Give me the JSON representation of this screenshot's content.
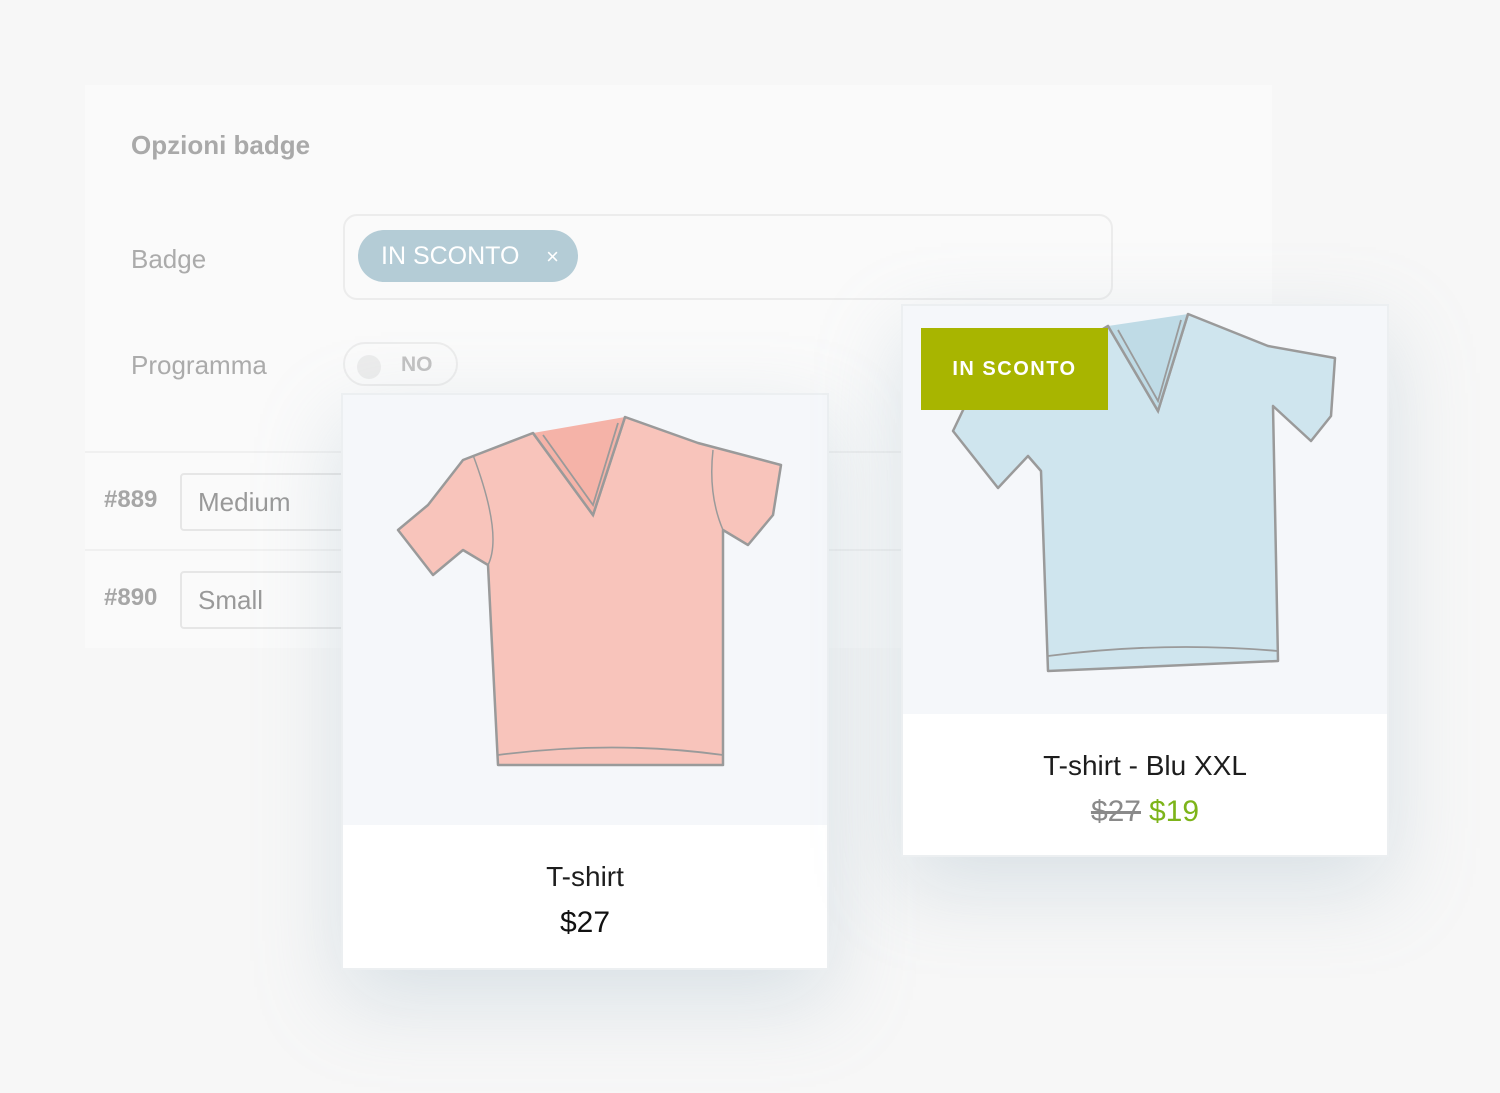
{
  "settings": {
    "title": "Opzioni badge",
    "badge_label": "Badge",
    "badge_tag": "IN SCONTO",
    "badge_tag_remove": "×",
    "schedule_label": "Programma",
    "schedule_toggle": "NO"
  },
  "variations": [
    {
      "id": "#889",
      "value": "Medium"
    },
    {
      "id": "#890",
      "value": "Small"
    }
  ],
  "products": [
    {
      "name": "T-shirt",
      "price": "$27",
      "color": "#f8c4bb",
      "image_icon": "tshirt-pink"
    },
    {
      "name": "T-shirt - Blu XXL",
      "old_price": "$27",
      "sale_price": "$19",
      "badge": "IN SCONTO",
      "color": "#cfe5ee",
      "image_icon": "tshirt-blue"
    }
  ],
  "colors": {
    "badge_green": "#a8b500",
    "sale_price": "#7db41a",
    "tag_blue": "#b4ccd6"
  }
}
